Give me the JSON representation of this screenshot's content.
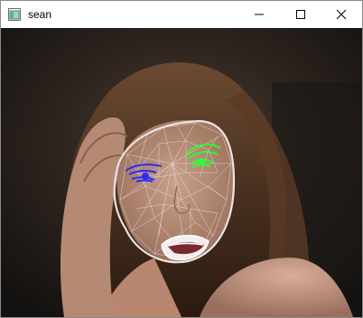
{
  "window": {
    "title": "sean"
  },
  "icons": {
    "app": "opencv-window-icon",
    "minimize": "minimize-icon",
    "maximize": "maximize-icon",
    "close": "close-icon"
  },
  "overlay": {
    "mesh_color": "#e9e4e2",
    "left_eye_color": "#2b2bff",
    "right_eye_color": "#2cff2c"
  }
}
